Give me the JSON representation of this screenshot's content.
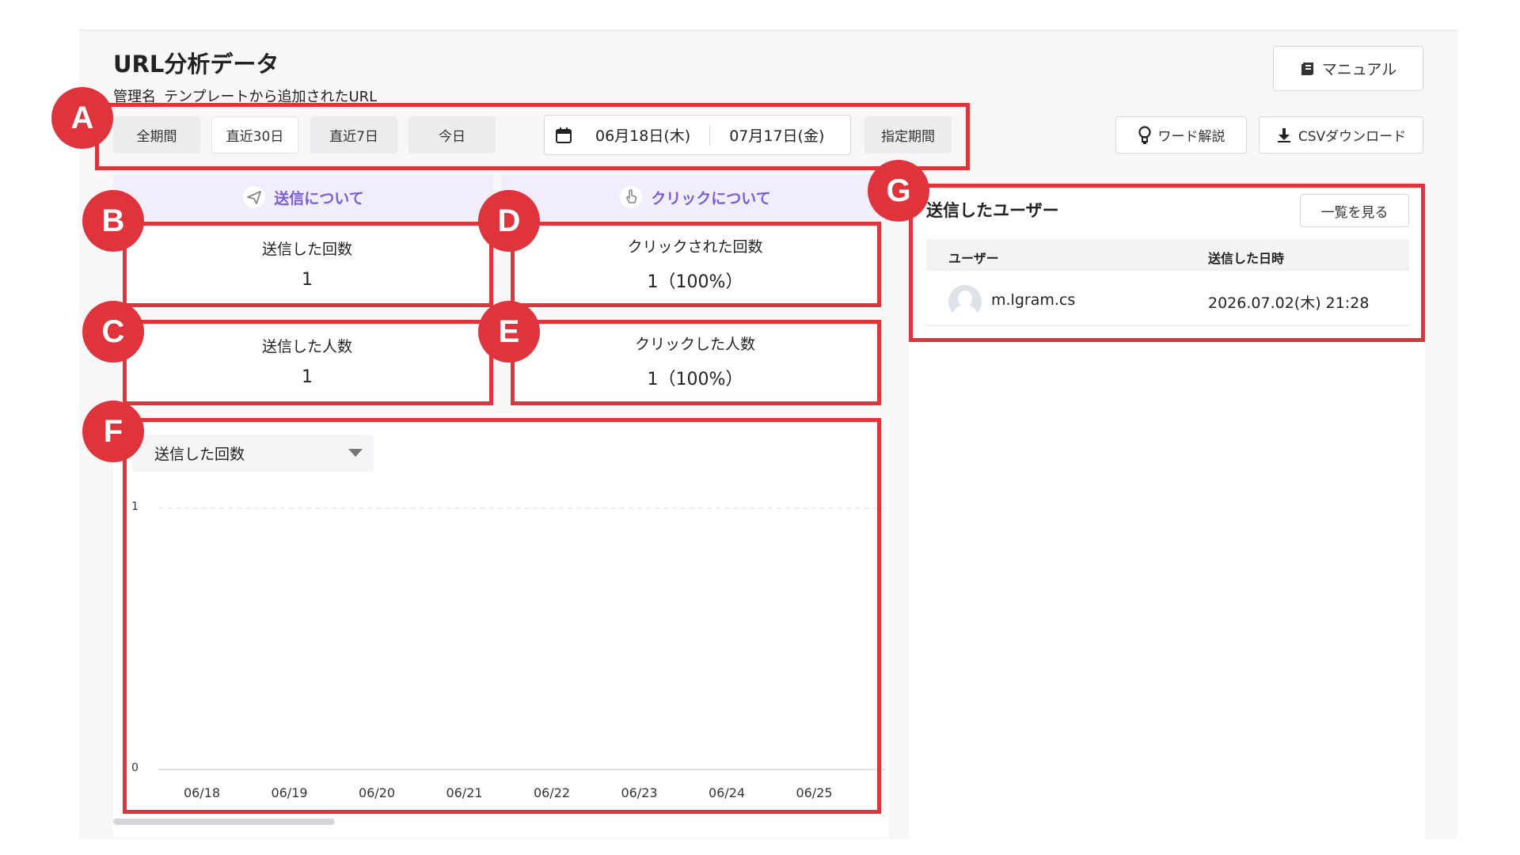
{
  "page": {
    "title": "URL分析データ",
    "subtitle_label": "管理名",
    "subtitle_value": "テンプレートから追加されたURL"
  },
  "toolbar": {
    "manual_label": "マニュアル",
    "word_label": "ワード解説",
    "csv_label": "CSVダウンロード"
  },
  "period": {
    "buttons": [
      "全期間",
      "直近30日",
      "直近7日",
      "今日"
    ],
    "active_index": 1,
    "date_from": "06月18日(木)",
    "date_to": "07月17日(金)",
    "custom_label": "指定期間"
  },
  "sections": {
    "send_title": "送信について",
    "click_title": "クリックについて"
  },
  "stats": {
    "send_count": {
      "label": "送信した回数",
      "value": "1"
    },
    "send_people": {
      "label": "送信した人数",
      "value": "1"
    },
    "click_count": {
      "label": "クリックされた回数",
      "value": "1（100%）"
    },
    "click_people": {
      "label": "クリックした人数",
      "value": "1（100%）"
    }
  },
  "chart": {
    "selector_value": "送信した回数"
  },
  "chart_data": {
    "type": "line",
    "categories": [
      "06/18",
      "06/19",
      "06/20",
      "06/21",
      "06/22",
      "06/23",
      "06/24",
      "06/25"
    ],
    "y_ticks": [
      "1",
      "0"
    ],
    "ylim": [
      0,
      1
    ],
    "grid": true
  },
  "users": {
    "title": "送信したユーザー",
    "list_button": "一覧を見る",
    "col_user": "ユーザー",
    "col_date": "送信した日時",
    "rows": [
      {
        "name": "m.lgram.cs",
        "date": "2026.07.02(木) 21:28"
      }
    ]
  },
  "annotations": {
    "A": "A",
    "B": "B",
    "C": "C",
    "D": "D",
    "E": "E",
    "F": "F",
    "G": "G",
    "color": "#e0343c"
  }
}
